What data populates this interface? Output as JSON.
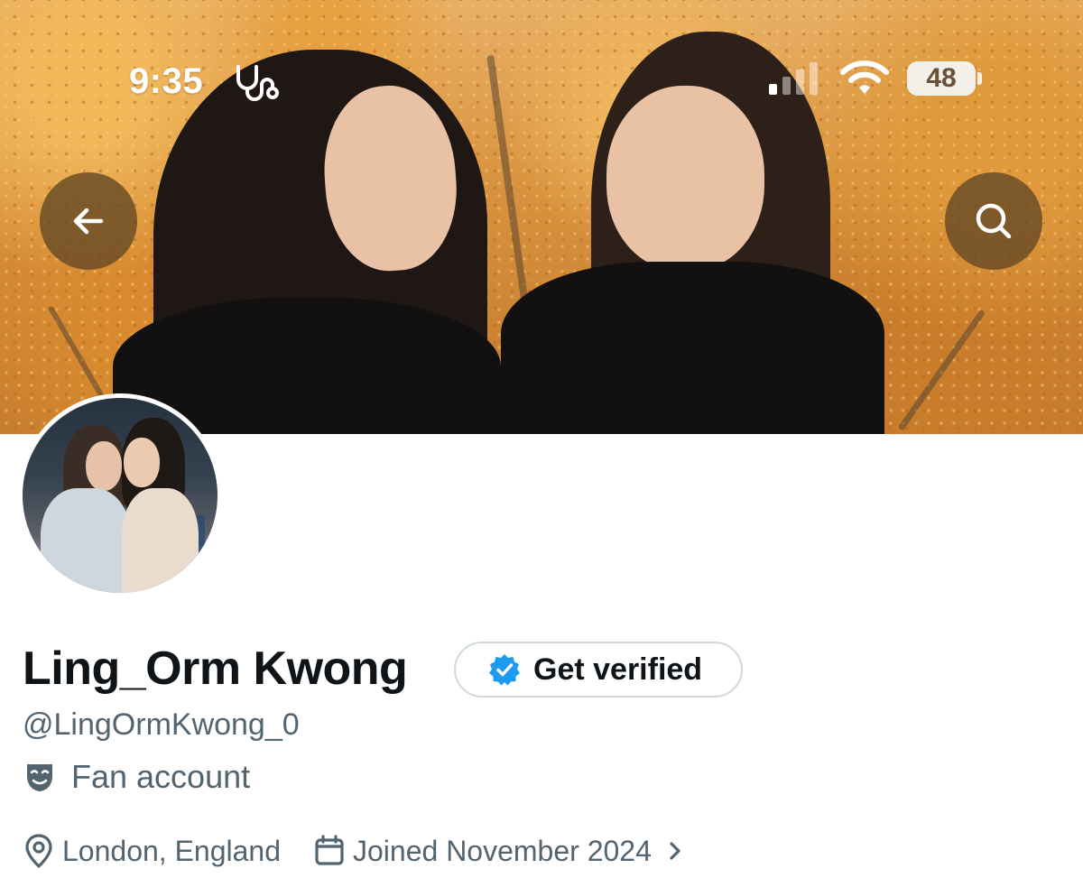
{
  "status_bar": {
    "time": "9:35",
    "battery": "48",
    "icons": [
      "stethoscope-icon",
      "signal-icon",
      "wifi-icon",
      "battery-icon"
    ]
  },
  "header": {
    "back_icon": "arrow-left-icon",
    "search_icon": "search-icon"
  },
  "profile": {
    "display_name": "Ling_Orm Kwong",
    "verify_button": "Get verified",
    "handle": "@LingOrmKwong_0",
    "category": "Fan account",
    "location": "London, England",
    "joined": "Joined November 2024"
  },
  "colors": {
    "text_primary": "#0f1419",
    "text_secondary": "#536471",
    "verified_blue": "#1d9bf0",
    "button_border": "#cfd9de"
  }
}
